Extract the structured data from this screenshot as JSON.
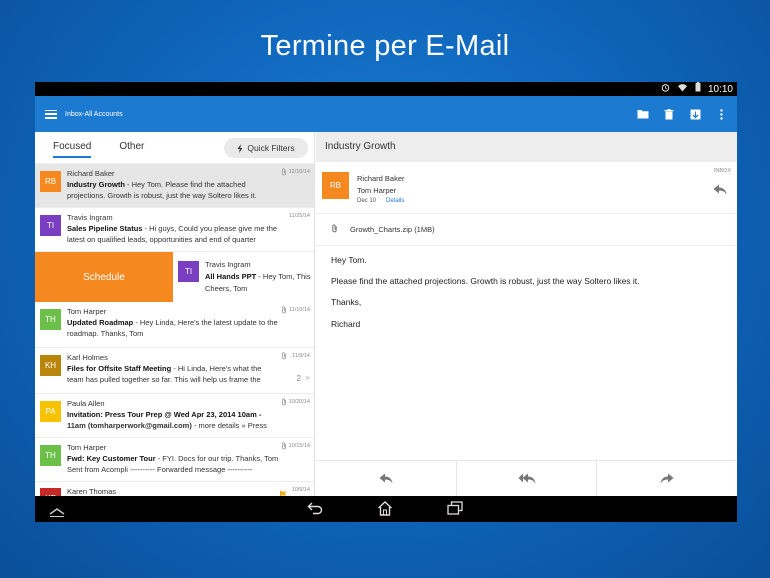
{
  "promo": {
    "title": "Termine per E-Mail"
  },
  "status_bar": {
    "time": "10:10"
  },
  "app_bar": {
    "account": "Inbox-All Accounts"
  },
  "tabs": {
    "focused": "Focused",
    "other": "Other",
    "quick_filters": "Quick Filters"
  },
  "messages": [
    {
      "initials": "RB",
      "color": "#f5891f",
      "sender": "Richard Baker",
      "subject": "Industry Growth",
      "preview1": " - Hey Tom. Please find the attached",
      "preview2": "projections. Growth is robust, just the way Soltero likes it.",
      "date": "12/10/14",
      "attachment": true
    },
    {
      "initials": "TI",
      "color": "#7a3fc1",
      "sender": "Travis Ingram",
      "subject": "Sales Pipeline Status",
      "preview1": " - Hi guys, Could you please give me the",
      "preview2": "latest on qualified leads, opportunities and end of quarter",
      "date": "11/25/14",
      "attachment": false
    },
    {
      "initials": "TH",
      "color": "#6cc04a",
      "sender": "Tom Harper",
      "subject": "Updated Roadmap",
      "preview1": " - Hey Linda, Here's the latest update to the",
      "preview2": "roadmap. Thanks, Tom",
      "date": "11/10/14",
      "attachment": true
    },
    {
      "initials": "KH",
      "color": "#b8860b",
      "sender": "Karl Holmes",
      "subject": "Files for Offsite Staff Meeting",
      "preview1": " - Hi Linda, Here's what the",
      "preview2": "team has pulled together so far. This will help us frame the",
      "date": "11/9/14",
      "attachment": true,
      "count": "2"
    },
    {
      "initials": "PA",
      "color": "#f7c200",
      "sender": "Paula Allen",
      "subject": "Invitation: Press Tour Prep @ Wed Apr 23, 2014 10am -",
      "preview1": "",
      "preview2_bold": "11am (tomharperwork@gmail.com)",
      "preview2": " - more details » Press",
      "date": "10/20/14",
      "attachment": true
    },
    {
      "initials": "TH",
      "color": "#6cc04a",
      "sender": "Tom Harper",
      "subject": "Fwd: Key Customer Tour",
      "preview1": " - FYI. Docs for our trip. Thanks, Tom",
      "preview2": "Sent from Acompli ---------- Forwarded message ----------",
      "date": "10/15/14",
      "attachment": true
    },
    {
      "initials": "KT",
      "color": "#c62828",
      "sender": "Karen Thomas",
      "subject": "",
      "preview1": "",
      "preview2": "",
      "date": "10/9/14",
      "attachment": false
    }
  ],
  "swiped_message": {
    "action_label": "Schedule",
    "initials": "TI",
    "color": "#7a3fc1",
    "sender": "Travis Ingram",
    "subject": "All Hands PPT",
    "preview1": " - Hey Tom, This",
    "preview2": "Cheers, Tom"
  },
  "reading": {
    "subject": "Industry Growth",
    "from": "Richard Baker",
    "initials": "RB",
    "to": "Tom Harper",
    "date": "Dec 10",
    "details_link": "Details",
    "folder": "INBOX",
    "attachment_name": "Growth_Charts.zip (1MB)",
    "body": [
      "Hey Tom.",
      "Please find the attached projections. Growth is robust, just the way Soltero likes it.",
      "Thanks,",
      "Richard"
    ]
  },
  "colors": {
    "accent": "#1d7ad1",
    "schedule": "#f5891f"
  }
}
